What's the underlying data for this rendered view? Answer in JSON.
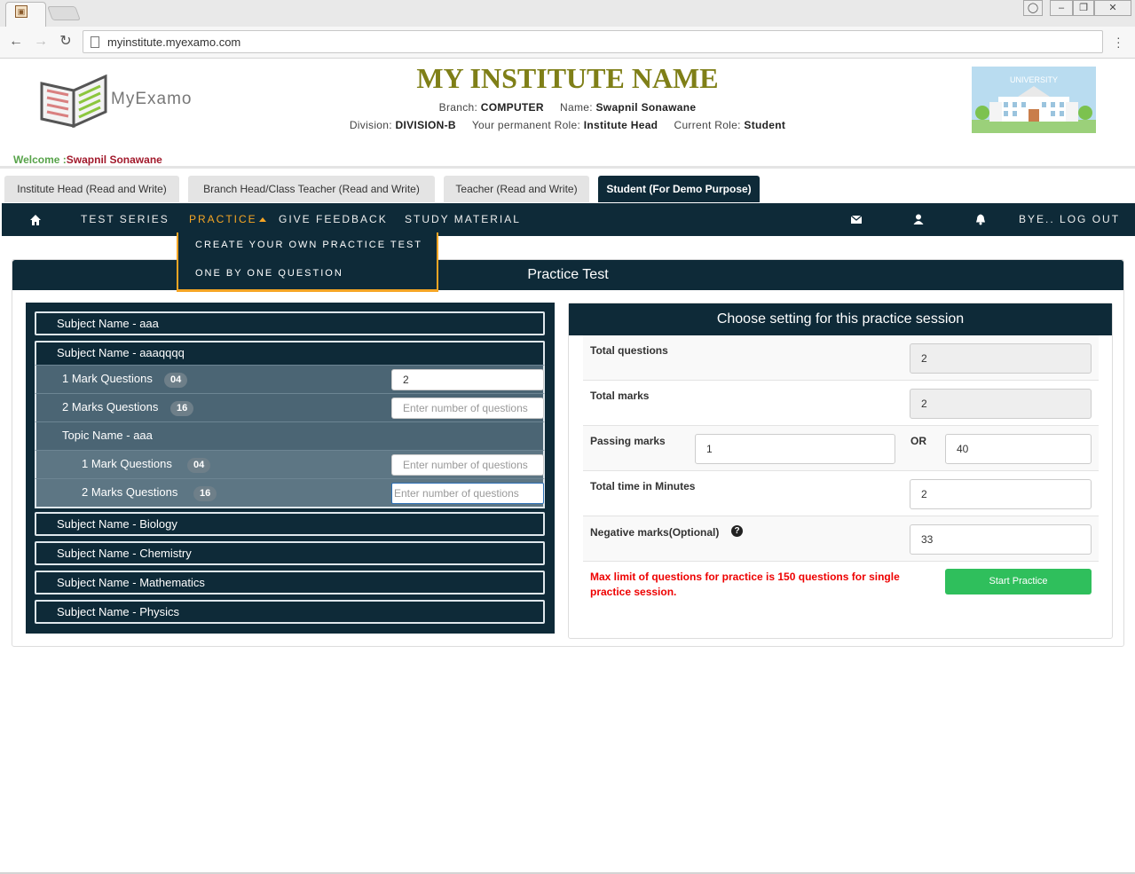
{
  "browser": {
    "url": "myinstitute.myexamo.com",
    "tab_favicon": "myexamo-favicon",
    "window_controls": [
      "user-icon",
      "minimize-icon",
      "restore-icon",
      "close-icon"
    ]
  },
  "header": {
    "logo_text": "MyExamo",
    "institute_name": "MY INSTITUTE NAME",
    "branch_label": "Branch:",
    "branch_value": "COMPUTER",
    "name_label": "Name:",
    "name_value": "Swapnil Sonawane",
    "division_label": "Division:",
    "division_value": "DIVISION-B",
    "perm_role_label": "Your permanent Role:",
    "perm_role_value": "Institute Head",
    "current_role_label": "Current Role:",
    "current_role_value": "Student",
    "university_caption": "UNIVERSITY",
    "welcome_label": "Welcome :",
    "welcome_name": "Swapnil Sonawane"
  },
  "role_tabs": [
    {
      "label": "Institute Head (Read and Write)",
      "active": false
    },
    {
      "label": "Branch Head/Class Teacher (Read and Write)",
      "active": false
    },
    {
      "label": "Teacher (Read and Write)",
      "active": false
    },
    {
      "label": "Student (For Demo Purpose)",
      "active": true
    }
  ],
  "nav": {
    "home_icon": "home-icon",
    "items": [
      "TEST SERIES",
      "PRACTICE",
      "GIVE FEEDBACK",
      "STUDY MATERIAL"
    ],
    "active": "PRACTICE",
    "icons": [
      "envelope-icon",
      "user-icon",
      "bell-icon"
    ],
    "logout": "BYE.. LOG OUT",
    "dropdown": [
      "CREATE YOUR OWN PRACTICE TEST",
      "ONE BY ONE QUESTION"
    ]
  },
  "panel": {
    "title": "Practice Test"
  },
  "subjects": {
    "s1": "Subject Name - aaa",
    "s2": "Subject Name - aaaqqqq",
    "s2_rows": [
      {
        "label": "1 Mark Questions",
        "count": "04",
        "value": "2",
        "placeholder": ""
      },
      {
        "label": "2 Marks Questions",
        "count": "16",
        "value": "",
        "placeholder": "Enter number of questions"
      }
    ],
    "topic": "Topic Name - aaa",
    "topic_rows": [
      {
        "label": "1 Mark Questions",
        "count": "04",
        "value": "",
        "placeholder": "Enter number of questions"
      },
      {
        "label": "2 Marks Questions",
        "count": "16",
        "value": "",
        "placeholder": "Enter number of questions"
      }
    ],
    "others": [
      "Subject Name - Biology",
      "Subject Name - Chemistry",
      "Subject Name - Mathematics",
      "Subject Name - Physics"
    ]
  },
  "settings": {
    "title": "Choose setting for this practice session",
    "total_questions_label": "Total questions",
    "total_questions_value": "2",
    "total_marks_label": "Total marks",
    "total_marks_value": "2",
    "passing_marks_label": "Passing marks",
    "passing_marks_value": "1",
    "or_label": "OR",
    "passing_percent_value": "40",
    "total_time_label": "Total time in Minutes",
    "total_time_value": "2",
    "negative_label": "Negative marks(Optional)",
    "negative_value": "33",
    "help_icon": "question-circle-icon",
    "warning": "Max limit of questions for practice is 150 questions for single practice session.",
    "start_button": "Start Practice"
  }
}
